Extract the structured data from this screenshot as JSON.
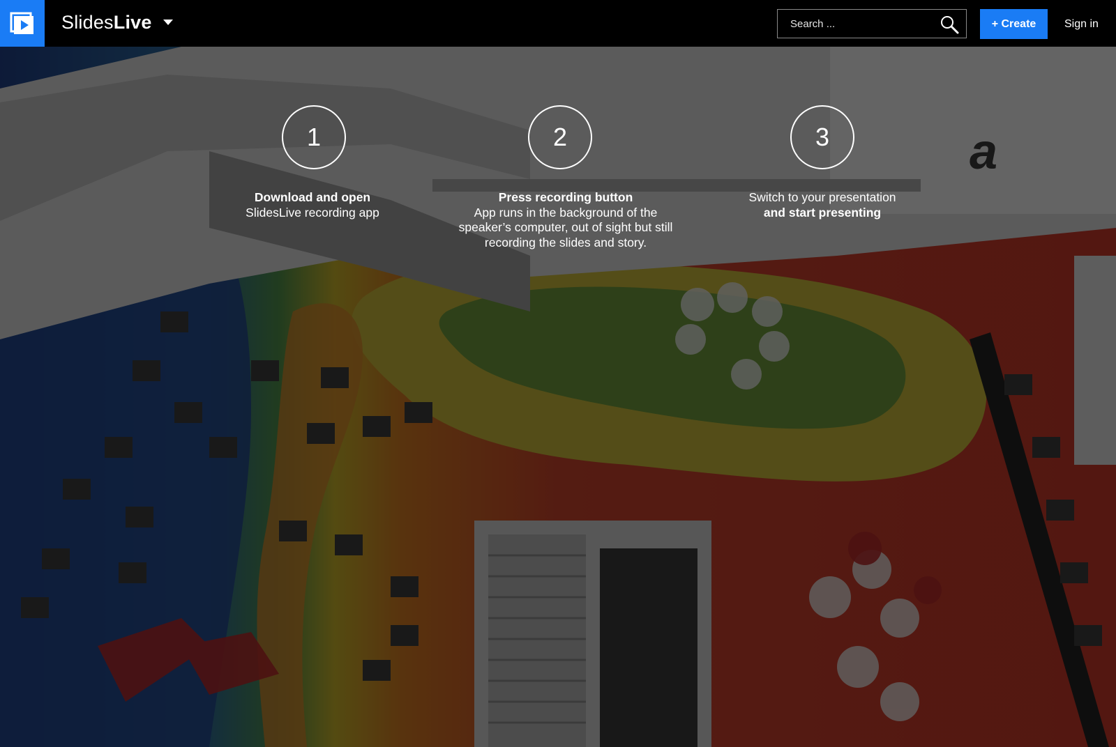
{
  "navbar": {
    "brand_light": "Slides",
    "brand_bold": "Live",
    "search_placeholder": "Search ...",
    "create_label": "+ Create",
    "signin_label": "Sign in"
  },
  "steps": [
    {
      "number": "1",
      "line1": "Download and open",
      "line2": "SlidesLive recording app"
    },
    {
      "number": "2",
      "line1": "Press recording button",
      "line2": "App runs in the background of the speaker’s computer, out of sight but still recording the slides and story."
    },
    {
      "number": "3",
      "line1": "Switch to your presentation",
      "line2": "and start presenting"
    }
  ],
  "colors": {
    "brand_blue": "#1a7cf5",
    "navbar_bg": "#000000"
  }
}
